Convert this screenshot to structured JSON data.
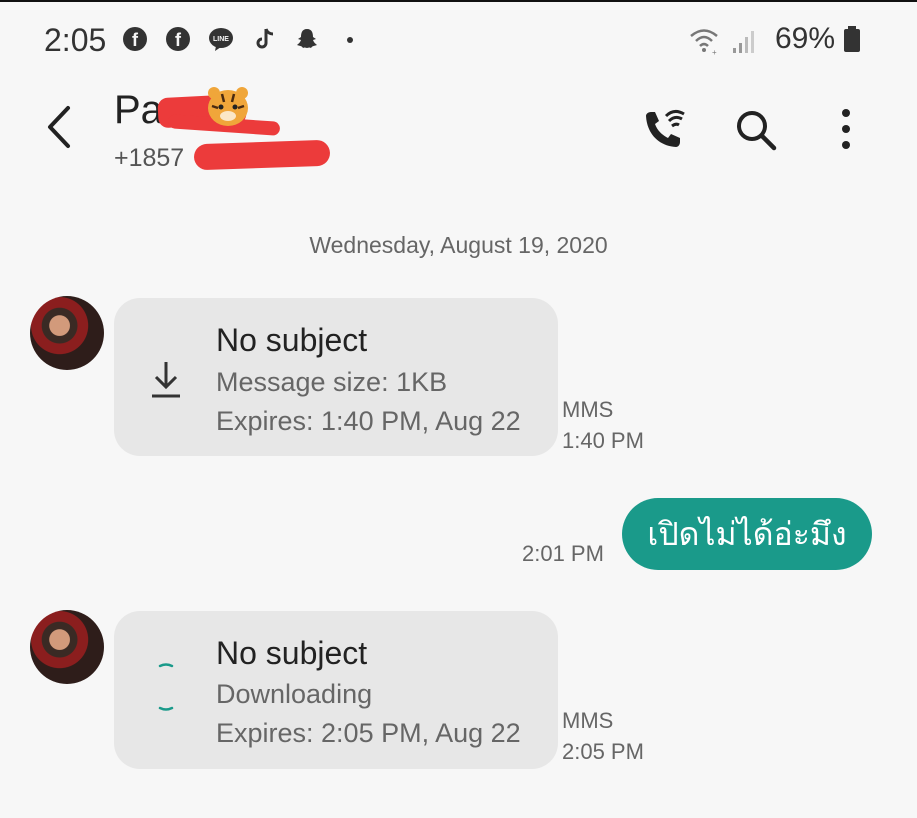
{
  "status_bar": {
    "time": "2:05",
    "battery_percent": "69%",
    "app_icons": [
      "facebook-icon",
      "facebook-icon",
      "line-icon",
      "tiktok-icon",
      "snapchat-icon",
      "dot-icon"
    ]
  },
  "header": {
    "contact_name": "Pa",
    "contact_number": "+1857",
    "actions": [
      "wifi-call-icon",
      "search-icon",
      "more-icon"
    ]
  },
  "conversation": {
    "date_label": "Wednesday, August 19, 2020",
    "messages": [
      {
        "direction": "incoming",
        "title": "No subject",
        "line1": "Message size: 1KB",
        "line2": "Expires: 1:40 PM, Aug 22",
        "type": "MMS",
        "time": "1:40 PM",
        "icon": "download-icon"
      },
      {
        "direction": "outgoing",
        "text": "เปิดไม่ได้อ่ะมึง",
        "time": "2:01 PM"
      },
      {
        "direction": "incoming",
        "title": "No subject",
        "line1": "Downloading",
        "line2": "Expires: 2:05 PM, Aug 22",
        "type": "MMS",
        "time": "2:05 PM",
        "icon": "loading-spinner-icon"
      }
    ]
  },
  "colors": {
    "accent": "#1a9a8a",
    "bubble_incoming": "#e7e7e7",
    "redaction": "#ec3b3b"
  }
}
